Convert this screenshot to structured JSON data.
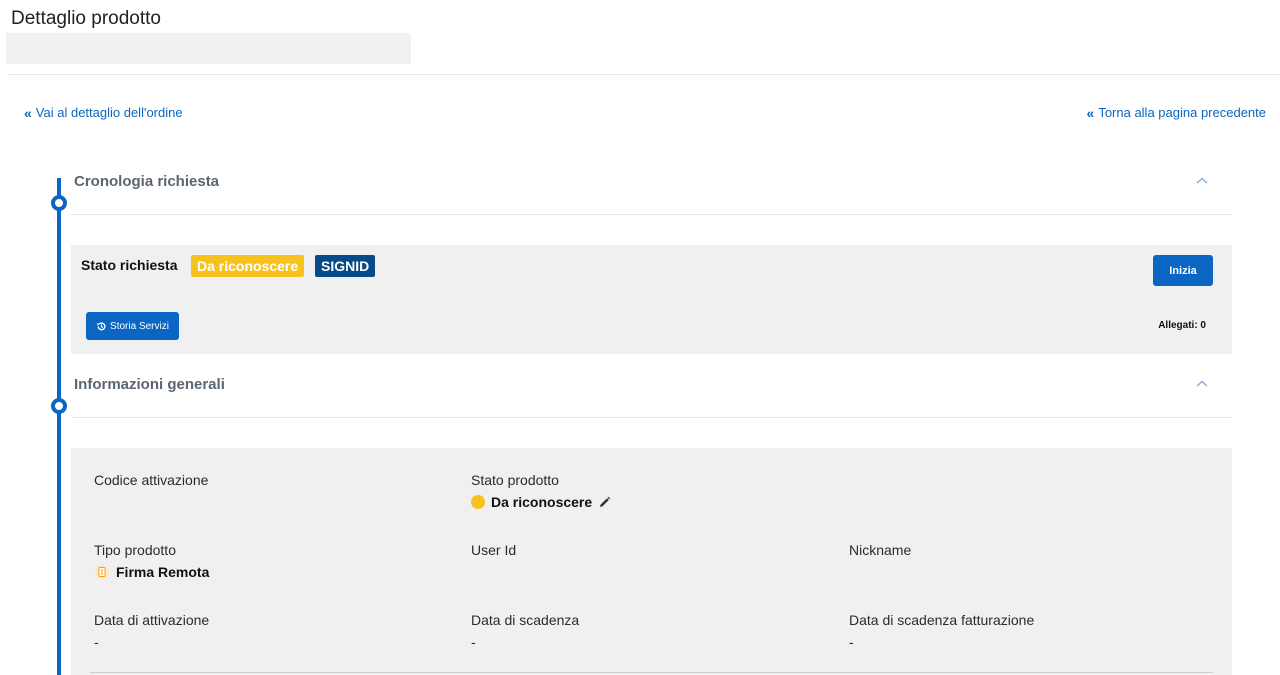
{
  "header": {
    "title": "Dettaglio prodotto"
  },
  "links": {
    "order_detail": "Vai al dettaglio dell'ordine",
    "back": "Torna alla pagina precedente"
  },
  "sections": {
    "history_title": "Cronologia richiesta",
    "general_title": "Informazioni generali"
  },
  "request": {
    "status_label": "Stato richiesta",
    "status_badge": "Da riconoscere",
    "type_badge": "SIGNID",
    "start_button": "Inizia",
    "history_button": "Storia Servizi",
    "attachments": "Allegati: 0"
  },
  "info": {
    "activation_code": {
      "label": "Codice attivazione",
      "value": ""
    },
    "product_status": {
      "label": "Stato prodotto",
      "value": "Da riconoscere"
    },
    "product_type": {
      "label": "Tipo prodotto",
      "value": "Firma Remota"
    },
    "user_id": {
      "label": "User Id",
      "value": ""
    },
    "nickname": {
      "label": "Nickname",
      "value": ""
    },
    "activation_date": {
      "label": "Data di attivazione",
      "value": "-"
    },
    "expiry_date": {
      "label": "Data di scadenza",
      "value": "-"
    },
    "billing_expiry_date": {
      "label": "Data di scadenza fatturazione",
      "value": "-"
    }
  },
  "colors": {
    "primary": "#0a66c2",
    "badge_yellow": "#f8c21c",
    "badge_navy": "#064a8a",
    "panel_bg": "#f0f0f0"
  },
  "icons": {
    "double_chevron_left": "double-chevron-left-icon",
    "chevron_up": "chevron-up-icon",
    "history": "history-icon",
    "pencil": "pencil-icon",
    "remote_signature": "remote-signature-icon"
  }
}
